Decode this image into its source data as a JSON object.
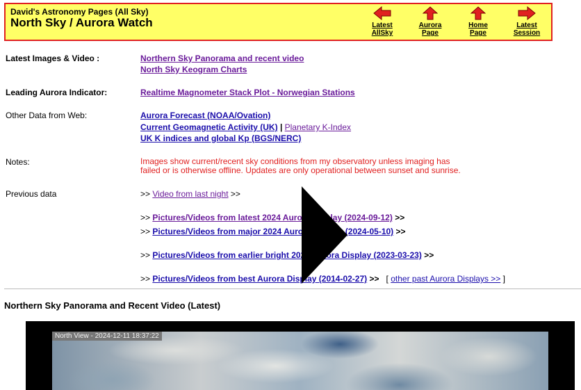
{
  "header": {
    "site_title": "David's Astronomy Pages (All Sky)",
    "page_title": "North Sky / Aurora Watch",
    "nav": [
      {
        "line1": "Latest",
        "line2": "AllSky",
        "direction": "left",
        "icon": "left-arrow-icon"
      },
      {
        "line1": "Aurora",
        "line2": "Page",
        "direction": "up",
        "icon": "up-arrow-icon"
      },
      {
        "line1": "Home",
        "line2": "Page",
        "direction": "up",
        "icon": "up-arrow-icon"
      },
      {
        "line1": "Latest",
        "line2": "Session",
        "direction": "right",
        "icon": "right-arrow-icon"
      }
    ]
  },
  "rows": {
    "latest": {
      "label": "Latest Images & Video :",
      "link1": "Northern Sky Panorama and recent video",
      "link2": "North Sky Keogram Charts"
    },
    "leading": {
      "label": "Leading Aurora Indicator:",
      "link": "Realtime Magnometer Stack Plot - Norwegian Stations"
    },
    "other": {
      "label": "Other Data from Web:",
      "link1": "Aurora Forecast (NOAA/Ovation)",
      "link2a": "Current Geomagnetic Activity (UK)",
      "separator": "|",
      "link2b": "Planetary K-Index",
      "link3": "UK K indices and global Kp (BGS/NERC)"
    },
    "notes": {
      "label": "Notes:",
      "line1": "Images show current/recent sky conditions from my observatory unless imaging has",
      "line2": "failed or is otherwise offline.  Updates are only operational between sunset and sunrise."
    },
    "previous": {
      "label": "Previous data",
      "prefix": ">>",
      "suffix": ">>",
      "video_link": "Video from last night",
      "items": [
        "Pictures/Videos from latest 2024 Aurora Display (2024-09-12)",
        "Pictures/Videos from major 2024 Aurora Display (2024-05-10)",
        "Pictures/Videos from earlier bright 2023 Aurora Display (2023-03-23)",
        "Pictures/Videos from best Aurora Display (2014-02-27)"
      ],
      "other_open": "[",
      "other_link": "other past Aurora Displays >>",
      "other_close": "]"
    }
  },
  "section": {
    "heading": "Northern Sky Panorama and Recent Video (Latest)"
  },
  "video": {
    "caption": "North View - 2024-12-11 18:37:22",
    "play_icon": "play-icon"
  },
  "colors": {
    "header_bg": "#ffff66",
    "header_border": "#e02020",
    "arrow": "#e02020",
    "link": "#1a0dab",
    "visited": "#6a1b9a",
    "note": "#e02020"
  }
}
